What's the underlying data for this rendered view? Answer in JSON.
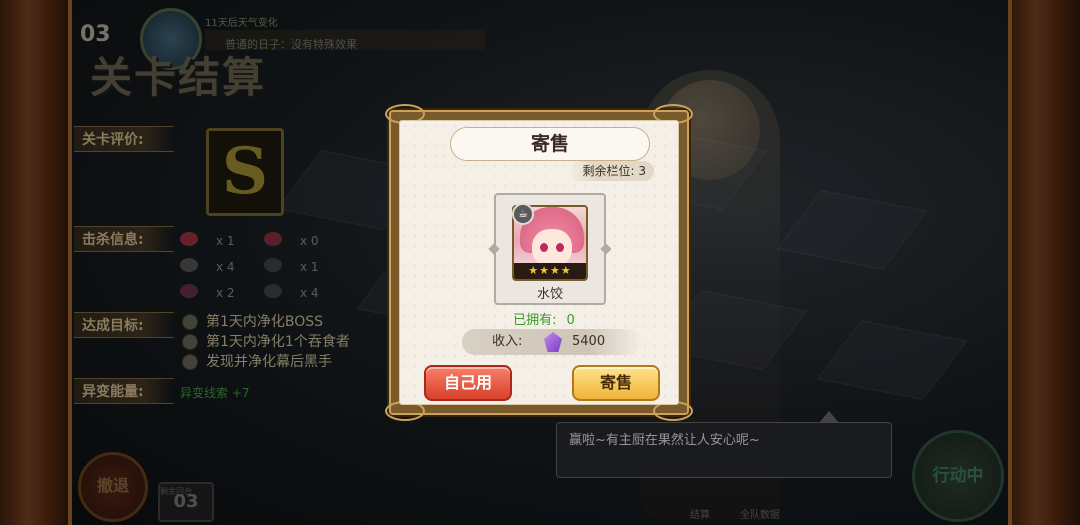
{
  "hud": {
    "stage_number": "03",
    "weather_text": "11天后天气变化",
    "status_text": "普通的日子：没有特殊效果"
  },
  "settlement": {
    "title": "关卡结算",
    "rating_label": "关卡评价:",
    "rating_grade": "S",
    "kill_label": "击杀信息:",
    "kills": [
      {
        "icon": "red-monster-icon",
        "count": "x 1"
      },
      {
        "icon": "red-boss-icon",
        "count": "x 0"
      },
      {
        "icon": "ghost-icon",
        "count": "x 4"
      },
      {
        "icon": "shadow-icon",
        "count": "x 1"
      },
      {
        "icon": "blob-icon",
        "count": "x 2"
      },
      {
        "icon": "slime-icon",
        "count": "x 4"
      }
    ],
    "goals_label": "达成目标:",
    "goals": [
      "第1天内净化BOSS",
      "第1天内净化1个吞食者",
      "发现并净化幕后黑手"
    ],
    "anomaly_label": "异变能量:",
    "anomaly_value": "异变线索 +7"
  },
  "bottom": {
    "left_button": "撤退",
    "count_label": "剩余回合",
    "count_value": "03",
    "right_button": "行动中",
    "speech": "赢啦~有主厨在果然让人安心呢~",
    "small_left": "结算",
    "small_right": "全队数据"
  },
  "dialog": {
    "title": "寄售",
    "slots_label": "剩余栏位: 3",
    "item_name": "水饺",
    "item_stars": "★★★★",
    "owned_label": "已拥有:",
    "owned_value": "0",
    "income_label": "收入:",
    "income_value": "5400",
    "use_button": "自己用",
    "sell_button": "寄售"
  },
  "colors": {
    "use_button": "#d8402c",
    "sell_button": "#f0b43a",
    "owned_text": "#3a9a2a",
    "gem": "#7a3ac0"
  }
}
